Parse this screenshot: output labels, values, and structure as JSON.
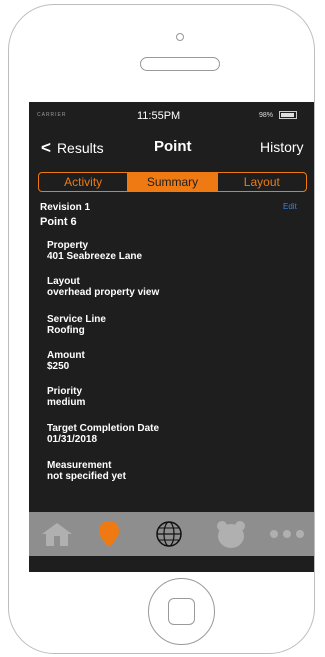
{
  "status_bar": {
    "carrier": "CARRIER",
    "time": "11:55PM",
    "battery": "98%"
  },
  "nav": {
    "back_label": "Results",
    "title": "Point",
    "right_label": "History"
  },
  "tabs": [
    {
      "label": "Activity",
      "active": false
    },
    {
      "label": "Summary",
      "active": true
    },
    {
      "label": "Layout",
      "active": false
    }
  ],
  "summary": {
    "revision": "Revision 1",
    "edit_label": "Edit",
    "point_name": "Point 6",
    "fields": [
      {
        "label": "Property",
        "value": "401 Seabreeze Lane"
      },
      {
        "label": "Layout",
        "value": "overhead property view"
      },
      {
        "label": "Service Line",
        "value": "Roofing"
      },
      {
        "label": "Amount",
        "value": "$250"
      },
      {
        "label": "Priority",
        "value": "medium"
      },
      {
        "label": "Target Completion Date",
        "value": "01/31/2018"
      },
      {
        "label": "Measurement",
        "value": "not specified yet"
      }
    ]
  },
  "tab_bar": {
    "items": [
      "home-icon",
      "location-pin-icon",
      "globe-icon",
      "bear-icon",
      "more-icon"
    ],
    "active_index": 1
  },
  "colors": {
    "accent": "#ef7a14",
    "screen_bg": "#1e1e1e",
    "link": "#3a82d8",
    "tabbar_bg": "#8e8e8e"
  }
}
